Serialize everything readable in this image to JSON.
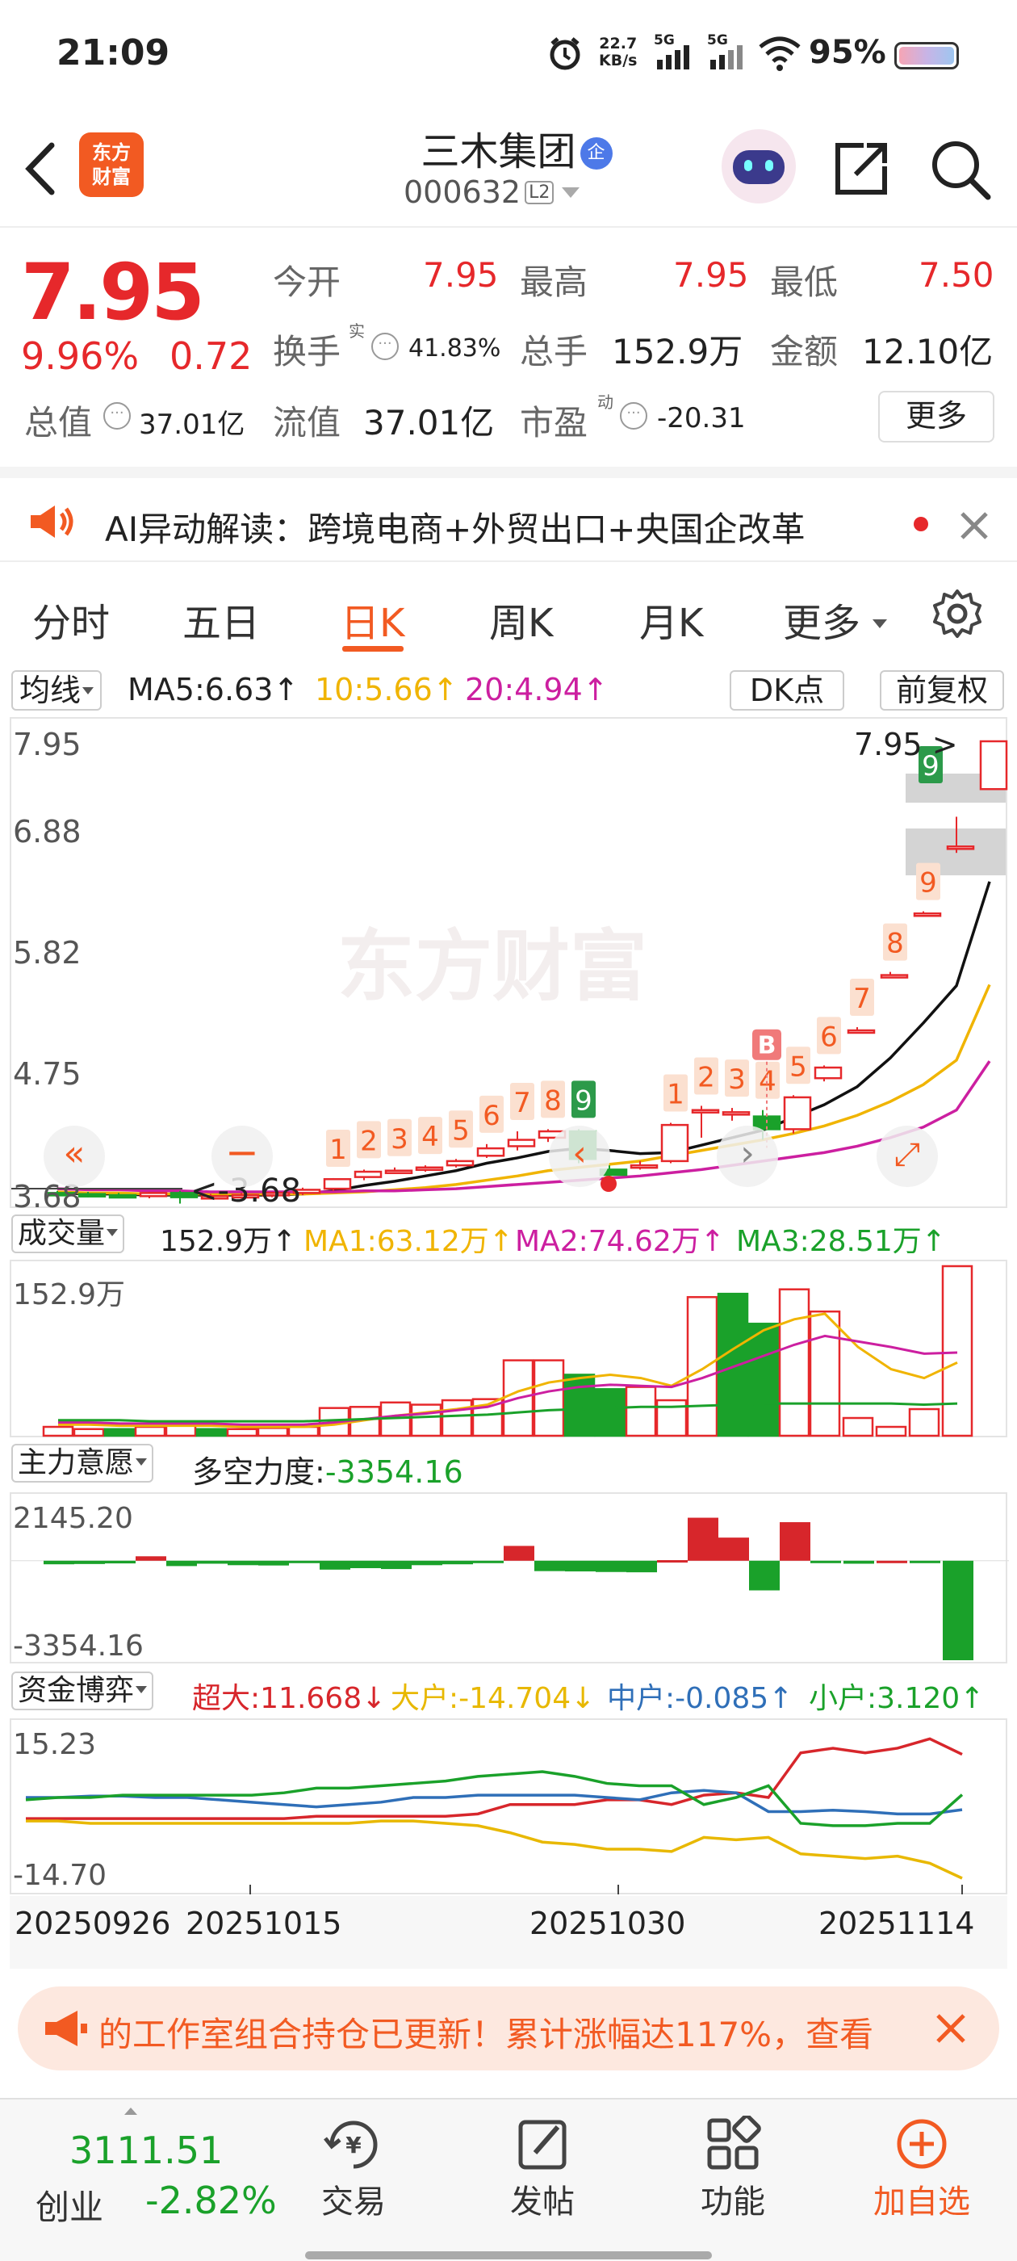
{
  "status_bar": {
    "time": "21:09",
    "net_speed_value": "22.7",
    "net_speed_unit": "KB/s",
    "signal1": "5G",
    "signal2": "5G",
    "battery": "95%"
  },
  "header": {
    "logo_line1": "东方",
    "logo_line2": "财富",
    "stock_name": "三木集团",
    "badge": "企",
    "stock_code": "000632",
    "level": "L2"
  },
  "quote": {
    "price": "7.95",
    "change_pct": "9.96%",
    "change_abs": "0.72",
    "open_label": "今开",
    "open": "7.95",
    "high_label": "最高",
    "high": "7.95",
    "low_label": "最低",
    "low": "7.50",
    "turnover_label": "换手",
    "turnover_sup": "实",
    "turnover": "41.83%",
    "volume_label": "总手",
    "volume": "152.9万",
    "amount_label": "金额",
    "amount": "12.10亿",
    "total_mv_label": "总值",
    "total_mv": "37.01亿",
    "float_mv_label": "流值",
    "float_mv": "37.01亿",
    "pe_label": "市盈",
    "pe_sup": "动",
    "pe": "-20.31",
    "more": "更多"
  },
  "ai_banner": {
    "text": "AI异动解读：跨境电商+外贸出口+央国企改革"
  },
  "tabs": [
    "分时",
    "五日",
    "日K",
    "周K",
    "月K",
    "更多"
  ],
  "active_tab": "日K",
  "ma_bar": {
    "selector": "均线",
    "ma5": "MA5:6.63↑",
    "ma10": "10:5.66↑",
    "ma20": "20:4.94↑",
    "dk": "DK点",
    "adjust": "前复权"
  },
  "kline": {
    "y_labels": [
      "7.95",
      "6.88",
      "5.82",
      "4.75",
      "3.68"
    ],
    "price_tag": "7.95",
    "low_tag": "<-3.68",
    "watermark": "东方财富",
    "buy_mark": "B",
    "seq_nums": [
      "1",
      "2",
      "3",
      "4",
      "5",
      "6",
      "7",
      "8",
      "9",
      "1",
      "2",
      "3",
      "4",
      "5",
      "6",
      "7",
      "8",
      "9"
    ]
  },
  "chart_data": {
    "type": "candlestick",
    "y_range": [
      3.68,
      7.95
    ],
    "date_labels": [
      "20250926",
      "20251015",
      "20251030",
      "20251114"
    ],
    "candles": [
      {
        "o": 3.7,
        "h": 3.72,
        "l": 3.66,
        "c": 3.69
      },
      {
        "o": 3.69,
        "h": 3.71,
        "l": 3.66,
        "c": 3.68
      },
      {
        "o": 3.68,
        "h": 3.7,
        "l": 3.66,
        "c": 3.67
      },
      {
        "o": 3.67,
        "h": 3.71,
        "l": 3.65,
        "c": 3.7
      },
      {
        "o": 3.7,
        "h": 3.72,
        "l": 3.6,
        "c": 3.66
      },
      {
        "o": 3.66,
        "h": 3.69,
        "l": 3.64,
        "c": 3.67
      },
      {
        "o": 3.67,
        "h": 3.7,
        "l": 3.65,
        "c": 3.68
      },
      {
        "o": 3.68,
        "h": 3.71,
        "l": 3.66,
        "c": 3.7
      },
      {
        "o": 3.7,
        "h": 3.75,
        "l": 3.68,
        "c": 3.73
      },
      {
        "o": 3.74,
        "h": 3.84,
        "l": 3.72,
        "c": 3.83
      },
      {
        "o": 3.85,
        "h": 3.92,
        "l": 3.82,
        "c": 3.9
      },
      {
        "o": 3.9,
        "h": 3.94,
        "l": 3.88,
        "c": 3.91
      },
      {
        "o": 3.92,
        "h": 3.96,
        "l": 3.9,
        "c": 3.94
      },
      {
        "o": 3.96,
        "h": 4.02,
        "l": 3.94,
        "c": 4.0
      },
      {
        "o": 4.05,
        "h": 4.16,
        "l": 4.03,
        "c": 4.12
      },
      {
        "o": 4.14,
        "h": 4.28,
        "l": 4.1,
        "c": 4.2
      },
      {
        "o": 4.22,
        "h": 4.3,
        "l": 4.18,
        "c": 4.28
      },
      {
        "o": 4.28,
        "h": 4.3,
        "l": 3.98,
        "c": 4.02
      },
      {
        "o": 3.92,
        "h": 3.96,
        "l": 3.85,
        "c": 3.87
      },
      {
        "o": 3.95,
        "h": 4.0,
        "l": 3.92,
        "c": 3.96
      },
      {
        "o": 4.0,
        "h": 4.36,
        "l": 3.98,
        "c": 4.34
      },
      {
        "o": 4.46,
        "h": 4.52,
        "l": 4.22,
        "c": 4.48
      },
      {
        "o": 4.44,
        "h": 4.5,
        "l": 4.38,
        "c": 4.46
      },
      {
        "o": 4.42,
        "h": 4.48,
        "l": 4.2,
        "c": 4.3
      },
      {
        "o": 4.3,
        "h": 4.62,
        "l": 4.26,
        "c": 4.6
      },
      {
        "o": 4.78,
        "h": 4.9,
        "l": 4.75,
        "c": 4.88
      },
      {
        "o": 5.23,
        "h": 5.26,
        "l": 5.2,
        "c": 5.23
      },
      {
        "o": 5.75,
        "h": 5.78,
        "l": 5.73,
        "c": 5.75
      },
      {
        "o": 6.33,
        "h": 6.35,
        "l": 6.3,
        "c": 6.33
      },
      {
        "o": 6.96,
        "h": 7.24,
        "l": 6.9,
        "c": 6.96
      },
      {
        "o": 7.5,
        "h": 7.95,
        "l": 7.5,
        "c": 7.95
      }
    ],
    "ma_series": [
      {
        "name": "MA5",
        "color": "#111111",
        "values": [
          3.7,
          3.69,
          3.69,
          3.68,
          3.68,
          3.68,
          3.68,
          3.68,
          3.69,
          3.72,
          3.77,
          3.81,
          3.86,
          3.91,
          3.98,
          4.03,
          4.09,
          4.12,
          4.1,
          4.07,
          4.08,
          4.15,
          4.22,
          4.29,
          4.41,
          4.53,
          4.7,
          4.97,
          5.3,
          5.65,
          6.63
        ]
      },
      {
        "name": "10",
        "color": "#f0b400",
        "values": [
          3.71,
          3.7,
          3.7,
          3.69,
          3.69,
          3.69,
          3.69,
          3.69,
          3.69,
          3.7,
          3.71,
          3.73,
          3.75,
          3.78,
          3.82,
          3.86,
          3.91,
          3.94,
          3.97,
          4.0,
          4.05,
          4.1,
          4.15,
          4.2,
          4.26,
          4.33,
          4.43,
          4.56,
          4.72,
          4.95,
          5.66
        ]
      },
      {
        "name": "20",
        "color": "#cc1fa0",
        "values": [
          3.74,
          3.73,
          3.73,
          3.72,
          3.72,
          3.71,
          3.71,
          3.71,
          3.71,
          3.71,
          3.72,
          3.72,
          3.73,
          3.74,
          3.76,
          3.78,
          3.8,
          3.82,
          3.84,
          3.86,
          3.89,
          3.92,
          3.96,
          4.0,
          4.04,
          4.08,
          4.14,
          4.22,
          4.32,
          4.48,
          4.94
        ]
      }
    ]
  },
  "volume": {
    "selector": "成交量",
    "current": "152.9万↑",
    "ma1": "MA1:63.12万↑",
    "ma2": "MA2:74.62万↑",
    "ma3": "MA3:28.51万↑",
    "y_top": "152.9万",
    "bars": [
      8,
      6,
      6,
      8,
      9,
      6,
      6,
      7,
      8,
      25,
      26,
      30,
      28,
      32,
      33,
      68,
      68,
      55,
      42,
      44,
      32,
      125,
      128,
      101,
      132,
      112,
      16,
      8,
      24,
      152.9
    ],
    "up": [
      1,
      1,
      0,
      1,
      1,
      0,
      1,
      1,
      1,
      1,
      1,
      1,
      1,
      1,
      1,
      1,
      1,
      0,
      0,
      1,
      1,
      1,
      0,
      0,
      1,
      1,
      1,
      1,
      1,
      1
    ],
    "ma_lines": [
      {
        "color": "#f0b400",
        "values": [
          10,
          10,
          9,
          9,
          9,
          9,
          8,
          8,
          8,
          10,
          14,
          18,
          21,
          24,
          28,
          40,
          48,
          52,
          55,
          52,
          45,
          60,
          78,
          95,
          105,
          110,
          80,
          60,
          52,
          66
        ]
      },
      {
        "color": "#cc1fa0",
        "values": [
          12,
          12,
          11,
          11,
          11,
          11,
          10,
          10,
          10,
          12,
          15,
          18,
          20,
          23,
          26,
          34,
          40,
          44,
          46,
          45,
          44,
          52,
          62,
          72,
          82,
          90,
          85,
          80,
          74,
          75
        ]
      },
      {
        "color": "#1aa12a",
        "values": [
          14,
          14,
          14,
          13,
          13,
          13,
          13,
          13,
          13,
          14,
          15,
          16,
          17,
          18,
          19,
          21,
          23,
          24,
          25,
          26,
          26,
          27,
          28,
          29,
          29,
          29,
          29,
          29,
          28,
          29
        ]
      }
    ]
  },
  "zhuli": {
    "selector": "主力意愿",
    "label": "多空力度:",
    "value": "-3354.16",
    "y_top": "2145.20",
    "y_bottom": "-3354.16",
    "bars": [
      -120,
      -110,
      -90,
      150,
      -180,
      -100,
      -150,
      -160,
      -80,
      -300,
      -250,
      -280,
      -150,
      -120,
      -80,
      500,
      -350,
      -360,
      -380,
      -390,
      20,
      1450,
      780,
      -1000,
      1300,
      -40,
      -100,
      0,
      -20,
      -3354.16
    ]
  },
  "zijin": {
    "selector": "资金博弈",
    "super_label": "超大:",
    "super_value": "11.668↓",
    "big_label": "大户:",
    "big_value": "-14.704↓",
    "mid_label": "中户:",
    "mid_value": "-0.085↑",
    "small_label": "小户:",
    "small_value": "3.120↑",
    "y_top": "15.23",
    "y_bottom": "-14.70",
    "lines": [
      {
        "color": "#d7262b",
        "values": [
          -2.0,
          -2.0,
          -2.0,
          -2.0,
          -2.0,
          -2.0,
          -2.0,
          -2.0,
          -2.0,
          -1.5,
          -1.5,
          -1.5,
          -1.5,
          -1.5,
          -1.0,
          1.0,
          1.0,
          1.0,
          2.0,
          2.0,
          1.0,
          3.0,
          3.5,
          2.5,
          12.0,
          13.0,
          12.0,
          13.0,
          15.0,
          11.7
        ]
      },
      {
        "color": "#e8b800",
        "values": [
          -2.5,
          -2.5,
          -3.0,
          -3.0,
          -3.0,
          -3.0,
          -3.0,
          -3.0,
          -3.0,
          -3.0,
          -3.0,
          -2.5,
          -2.5,
          -3.0,
          -3.5,
          -5.0,
          -7.0,
          -7.5,
          -8.5,
          -8.5,
          -9.0,
          -6.0,
          -6.5,
          -6.0,
          -9.5,
          -10.0,
          -10.5,
          -10.0,
          -11.5,
          -14.7
        ]
      },
      {
        "color": "#2f6fb8",
        "values": [
          2.5,
          2.5,
          2.8,
          2.8,
          2.5,
          2.5,
          2.0,
          1.5,
          1.0,
          0.5,
          1.0,
          1.5,
          2.5,
          2.5,
          3.0,
          3.0,
          3.0,
          3.0,
          2.5,
          2.0,
          3.5,
          4.0,
          3.5,
          -0.5,
          -0.5,
          -0.2,
          -0.5,
          -1.0,
          -1.0,
          -0.1
        ]
      },
      {
        "color": "#1aa12a",
        "values": [
          2.0,
          2.5,
          2.5,
          3.0,
          3.0,
          3.0,
          3.0,
          3.0,
          3.5,
          4.5,
          4.5,
          5.0,
          5.5,
          6.0,
          7.0,
          7.5,
          8.0,
          7.0,
          5.5,
          5.0,
          5.0,
          1.0,
          2.5,
          5.0,
          -3.0,
          -3.5,
          -3.5,
          -3.0,
          -3.0,
          3.1
        ]
      }
    ]
  },
  "promo": {
    "text": "的工作室组合持仓已更新！累计涨幅达117%，查看"
  },
  "bottom_nav": {
    "index_value": "3111.51",
    "index_name": "创业",
    "index_change": "-2.82%",
    "trade": "交易",
    "post": "发帖",
    "func": "功能",
    "watch": "加自选"
  }
}
